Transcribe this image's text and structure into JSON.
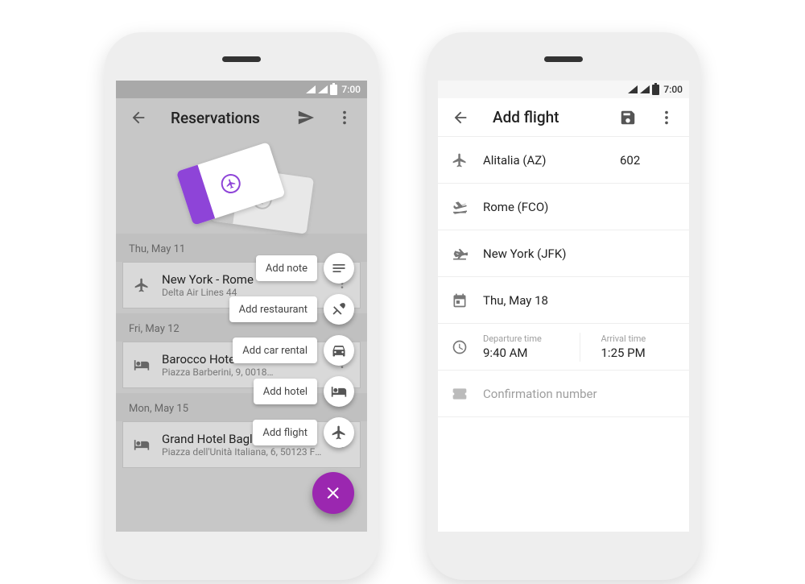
{
  "status": {
    "time": "7:00"
  },
  "colors": {
    "accent": "#9b27b0"
  },
  "left": {
    "title": "Reservations",
    "speeddial": {
      "note": "Add note",
      "restaurant": "Add restaurant",
      "car": "Add car rental",
      "hotel": "Add hotel",
      "flight": "Add flight"
    },
    "groups": [
      {
        "date": "Thu, May 11",
        "item": {
          "icon": "plane",
          "title": "New York - Rome",
          "subtitle": "Delta Air Lines 44"
        }
      },
      {
        "date": "Fri, May 12",
        "item": {
          "icon": "bed",
          "title": "Barocco Hotel",
          "subtitle": "Piazza Barberini, 9, 0018…"
        }
      },
      {
        "date": "Mon, May 15",
        "item": {
          "icon": "bed",
          "title": "Grand Hotel Baglioni",
          "subtitle": "Piazza dell'Unità Italiana, 6, 50123 Fire…"
        }
      }
    ]
  },
  "right": {
    "title": "Add flight",
    "airline": "Alitalia (AZ)",
    "flight_no": "602",
    "origin": "Rome (FCO)",
    "destination": "New York (JFK)",
    "date": "Thu, May 18",
    "dep_label": "Departure time",
    "dep_time": "9:40 AM",
    "arr_label": "Arrival time",
    "arr_time": "1:25 PM",
    "conf_placeholder": "Confirmation number"
  }
}
